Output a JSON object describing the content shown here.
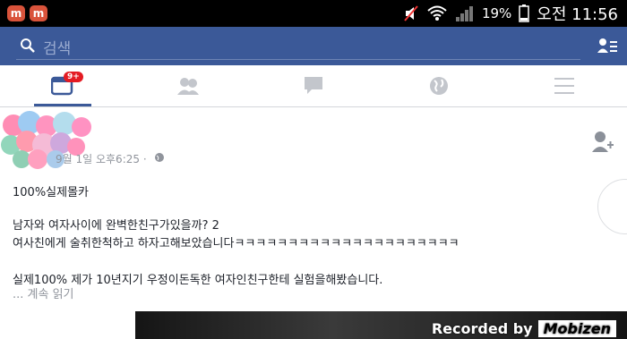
{
  "status": {
    "apps": [
      "m",
      "m"
    ],
    "battery": "19%",
    "time": "오전 11:56"
  },
  "search": {
    "placeholder": "검색"
  },
  "tabs": {
    "news_badge": "9+"
  },
  "post": {
    "timestamp": "9월 1일 오후6:25 · ",
    "line1": "100%실제몰카",
    "line2": "남자와 여자사이에 완벽한친구가있을까? 2",
    "line3": "여사친에게 술취한척하고 하자고해보았습니다ㅋㅋㅋㅋㅋㅋㅋㅋㅋㅋㅋㅋㅋㅋㅋㅋㅋㅋㅋㅋㅋ",
    "line4": "실제100% 제가 10년지기 우정이돈독한 여자인친구한테 실험을해봤습니다.",
    "more": "... 계속 읽기"
  },
  "watermark": {
    "recorded": "Recorded by",
    "brand": "Mobizen"
  }
}
